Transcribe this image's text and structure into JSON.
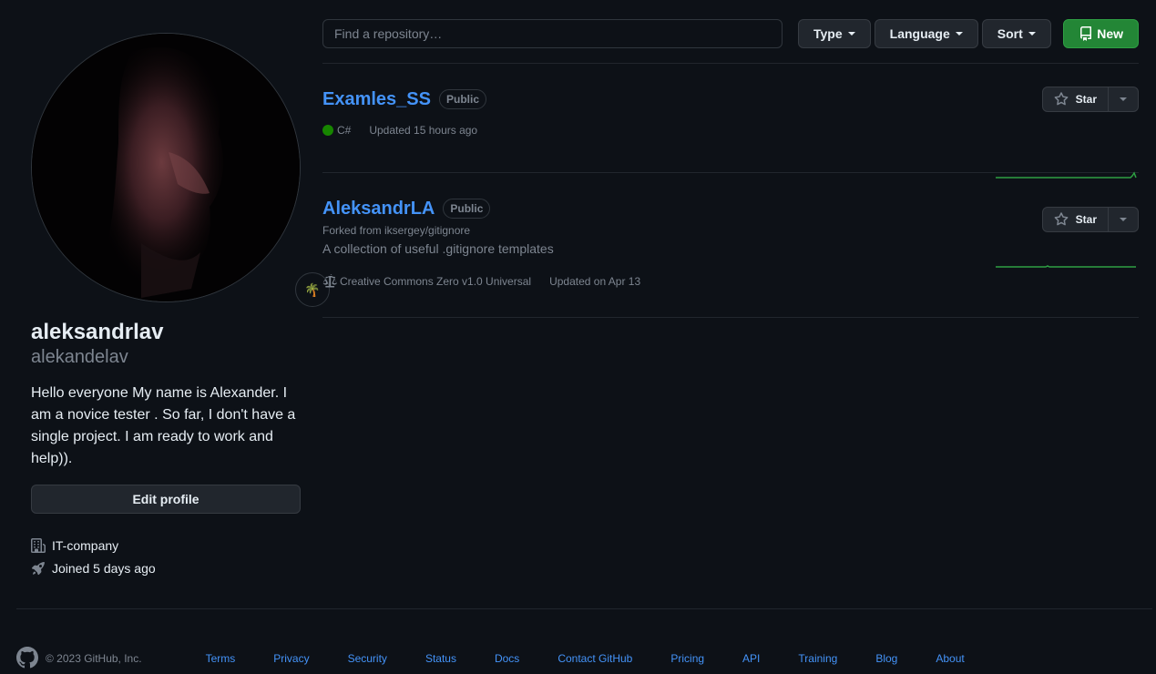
{
  "profile": {
    "display_name": "aleksandrlav",
    "username": "alekandelav",
    "status_emoji": "🌴",
    "bio": "Hello everyone My name is Alexander. I am a novice tester . So far, I don't have a single project. I am ready to work and help)).",
    "edit_label": "Edit profile",
    "company": "IT-company",
    "joined": "Joined 5 days ago"
  },
  "filters": {
    "search_placeholder": "Find a repository…",
    "type_label": "Type",
    "language_label": "Language",
    "sort_label": "Sort",
    "new_label": "New"
  },
  "repos": [
    {
      "name": "Examles_SS",
      "visibility": "Public",
      "language": "C#",
      "language_color": "#178600",
      "updated": "Updated 15 hours ago",
      "star_label": "Star"
    },
    {
      "name": "AleksandrLA",
      "visibility": "Public",
      "forked_from": "Forked from iksergey/gitignore",
      "description": "A collection of useful .gitignore templates",
      "license": "Creative Commons Zero v1.0 Universal",
      "updated": "Updated on Apr 13",
      "star_label": "Star"
    }
  ],
  "footer": {
    "copyright": "© 2023 GitHub, Inc.",
    "links": [
      "Terms",
      "Privacy",
      "Security",
      "Status",
      "Docs",
      "Contact GitHub",
      "Pricing",
      "API",
      "Training",
      "Blog",
      "About"
    ]
  },
  "colors": {
    "background": "#0d1117",
    "link": "#4493f8",
    "new_button": "#238636",
    "sparkline": "#2ea043"
  }
}
